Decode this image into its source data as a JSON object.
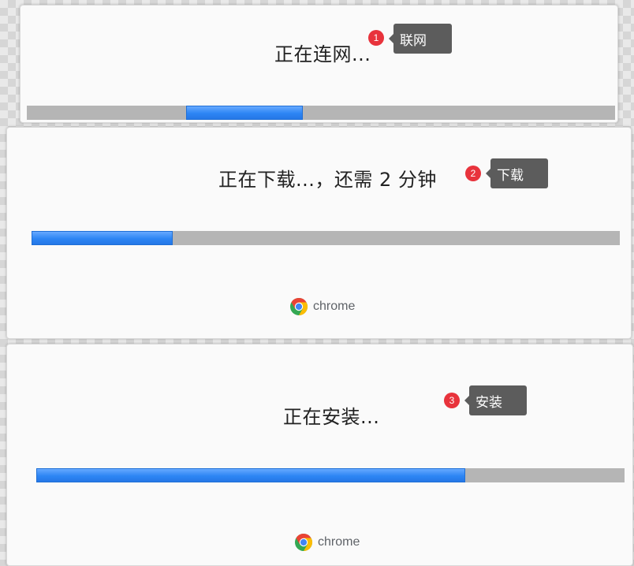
{
  "steps": [
    {
      "status": "正在连网...",
      "badge": "1",
      "tag": "联网",
      "progress_fraction": [
        0.27,
        0.46
      ]
    },
    {
      "status": "正在下载...，还需 2 分钟",
      "badge": "2",
      "tag": "下载",
      "progress_fraction": 0.24,
      "brand": "chrome"
    },
    {
      "status": "正在安装...",
      "badge": "3",
      "tag": "安装",
      "progress_fraction": 0.73,
      "brand": "chrome"
    }
  ],
  "colors": {
    "progress": "#2d86f4",
    "track": "#b5b5b5",
    "badge": "#e8333c",
    "tag": "#5c5c5c"
  },
  "icons": [
    "chrome-logo-icon"
  ]
}
